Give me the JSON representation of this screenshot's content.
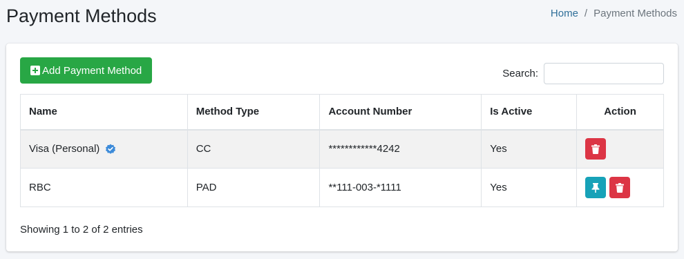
{
  "page": {
    "title": "Payment Methods"
  },
  "breadcrumb": {
    "home": "Home",
    "separator": "/",
    "current": "Payment Methods"
  },
  "toolbar": {
    "add_label": "Add Payment Method",
    "search_label": "Search:",
    "search_value": ""
  },
  "table": {
    "headers": [
      "Name",
      "Method Type",
      "Account Number",
      "Is Active",
      "Action"
    ],
    "rows": [
      {
        "name": "Visa (Personal)",
        "verified": true,
        "method_type": "CC",
        "account_number": "************4242",
        "is_active": "Yes",
        "actions": [
          "delete"
        ]
      },
      {
        "name": "RBC",
        "verified": false,
        "method_type": "PAD",
        "account_number": "**111-003-*1111",
        "is_active": "Yes",
        "actions": [
          "pin",
          "delete"
        ]
      }
    ]
  },
  "footer": {
    "info": "Showing 1 to 2 of 2 entries"
  },
  "colors": {
    "success": "#28a745",
    "danger": "#dc3545",
    "info": "#17a2b8",
    "link": "#2f6f99",
    "verified": "#3d8bd9"
  },
  "icons": {
    "add": "plus-square-icon",
    "verified": "check-badge-icon",
    "delete": "trash-icon",
    "pin": "thumbtack-icon"
  }
}
